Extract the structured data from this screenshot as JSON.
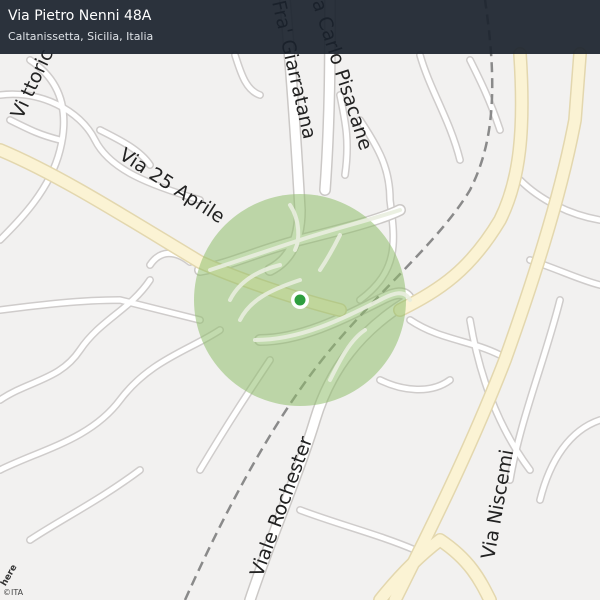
{
  "header": {
    "title": "Via Pietro Nenni 48A",
    "subtitle": "Caltanissetta, Sicilia, Italia"
  },
  "map": {
    "street_labels": [
      {
        "id": "via-25-aprile",
        "text": "Via  25  Aprile"
      },
      {
        "id": "fra-giarratana",
        "text": "Fra' Giarratana"
      },
      {
        "id": "carlo-pisacane",
        "text": "a Carlo Pisacane"
      },
      {
        "id": "viale-rochester",
        "text": "Viale Rochester"
      },
      {
        "id": "via-niscemi",
        "text": "Via  Niscemi"
      },
      {
        "id": "via-top-left",
        "text": "Vi   ttoric"
      }
    ],
    "accuracy_circle_color": "#8fbd6b",
    "location_dot_color": "#2e9e3e",
    "main_road_color": "#faf0cf"
  },
  "footer": {
    "copyright": "©ITA",
    "logo": "here"
  }
}
